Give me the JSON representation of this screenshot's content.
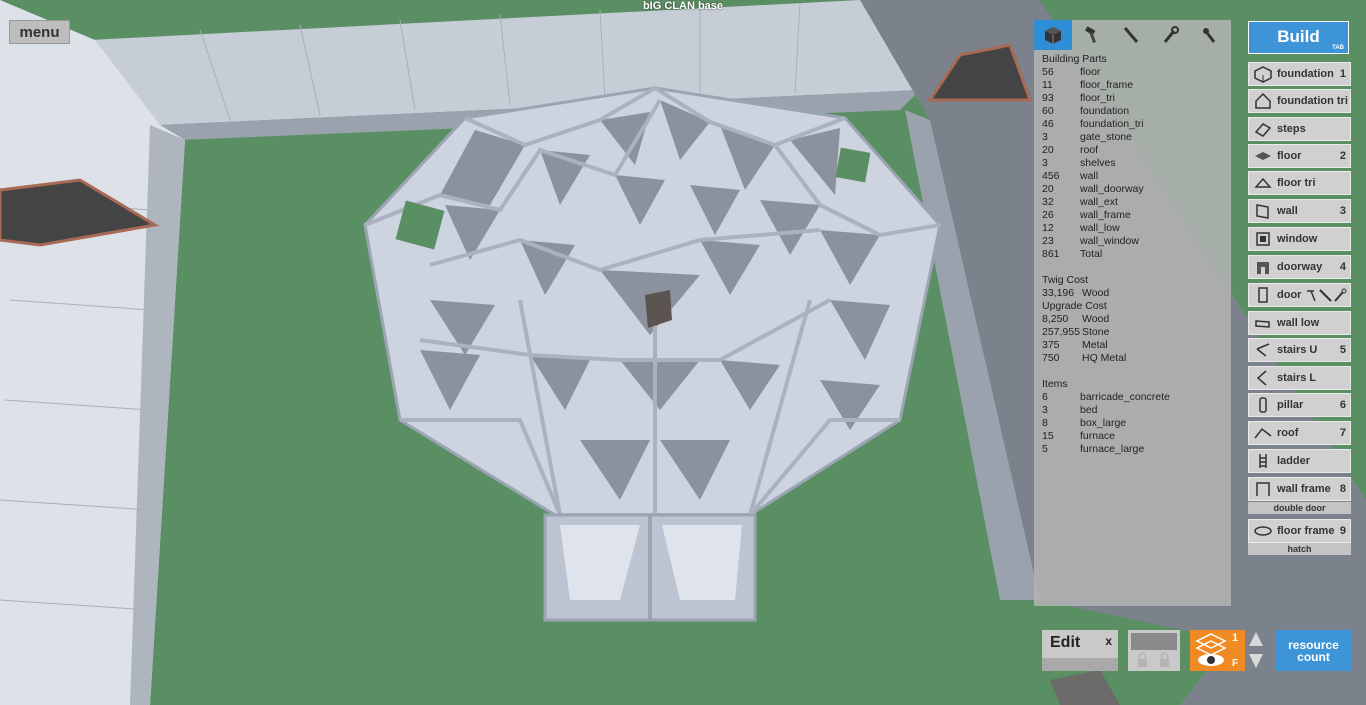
{
  "hud": {
    "base_name": "bIG CLAN base",
    "menu_label": "menu"
  },
  "tabs": [
    {
      "icon": "building-block-icon",
      "active": true
    },
    {
      "icon": "hammer-icon",
      "active": false
    },
    {
      "icon": "knife-icon",
      "active": false
    },
    {
      "icon": "wrench-icon",
      "active": false
    },
    {
      "icon": "pickaxe-icon",
      "active": false
    }
  ],
  "resource_panel": {
    "parts_heading": "Building Parts",
    "parts": [
      {
        "count": "56",
        "name": "floor"
      },
      {
        "count": "11",
        "name": "floor_frame"
      },
      {
        "count": "93",
        "name": "floor_tri"
      },
      {
        "count": "60",
        "name": "foundation"
      },
      {
        "count": "46",
        "name": "foundation_tri"
      },
      {
        "count": "3",
        "name": "gate_stone"
      },
      {
        "count": "20",
        "name": "roof"
      },
      {
        "count": "3",
        "name": "shelves"
      },
      {
        "count": "456",
        "name": "wall"
      },
      {
        "count": "20",
        "name": "wall_doorway"
      },
      {
        "count": "32",
        "name": "wall_ext"
      },
      {
        "count": "26",
        "name": "wall_frame"
      },
      {
        "count": "12",
        "name": "wall_low"
      },
      {
        "count": "23",
        "name": "wall_window"
      },
      {
        "count": "861",
        "name": "Total"
      }
    ],
    "twig_heading": "Twig Cost",
    "twig": [
      {
        "count": "33,196",
        "name": "Wood"
      }
    ],
    "upgrade_heading": "Upgrade Cost",
    "upgrade": [
      {
        "count": "8,250",
        "name": "Wood"
      },
      {
        "count": "257,955",
        "name": "Stone"
      },
      {
        "count": "375",
        "name": "Metal"
      },
      {
        "count": "750",
        "name": "HQ Metal"
      }
    ],
    "items_heading": "Items",
    "items": [
      {
        "count": "6",
        "name": "barricade_concrete"
      },
      {
        "count": "3",
        "name": "bed"
      },
      {
        "count": "8",
        "name": "box_large"
      },
      {
        "count": "15",
        "name": "furnace"
      },
      {
        "count": "5",
        "name": "furnace_large"
      }
    ]
  },
  "build_menu": {
    "build_label": "Build",
    "tab_hint": "TAB",
    "items": [
      {
        "label": "foundation",
        "key": "1",
        "icon": "foundation-icon"
      },
      {
        "label": "foundation tri",
        "key": "",
        "icon": "foundation-tri-icon"
      },
      {
        "label": "steps",
        "key": "",
        "icon": "steps-icon"
      },
      {
        "label": "floor",
        "key": "2",
        "icon": "floor-icon"
      },
      {
        "label": "floor tri",
        "key": "",
        "icon": "floor-tri-icon"
      },
      {
        "label": "wall",
        "key": "3",
        "icon": "wall-icon"
      },
      {
        "label": "window",
        "key": "",
        "icon": "window-icon"
      },
      {
        "label": "doorway",
        "key": "4",
        "icon": "doorway-icon"
      },
      {
        "label": "door",
        "key": "",
        "icon": "door-icon"
      },
      {
        "label": "wall low",
        "key": "",
        "icon": "wall-low-icon"
      },
      {
        "label": "stairs U",
        "key": "5",
        "icon": "stairs-u-icon"
      },
      {
        "label": "stairs L",
        "key": "",
        "icon": "stairs-l-icon"
      },
      {
        "label": "pillar",
        "key": "6",
        "icon": "pillar-icon"
      },
      {
        "label": "roof",
        "key": "7",
        "icon": "roof-icon"
      },
      {
        "label": "ladder",
        "key": "",
        "icon": "ladder-icon"
      },
      {
        "label": "wall frame",
        "key": "8",
        "icon": "wall-frame-icon"
      },
      {
        "label": "floor frame",
        "key": "9",
        "icon": "floor-frame-icon"
      }
    ],
    "sub_double_door": "double door",
    "sub_hatch": "hatch"
  },
  "bottom_bar": {
    "edit_label": "Edit",
    "edit_close": "x",
    "layer_number": "1",
    "layer_key": "F",
    "resource_label": "resource count"
  },
  "colors": {
    "accent_blue": "#3d95d8",
    "layer_orange": "#f08a24",
    "grass": "#5a8f63"
  }
}
